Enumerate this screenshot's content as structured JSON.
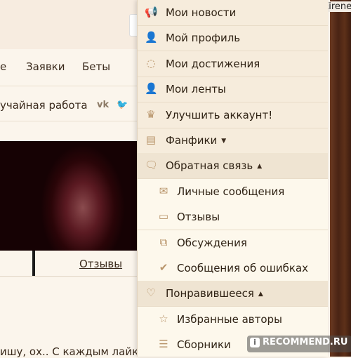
{
  "header": {
    "username": "Eirene"
  },
  "background_nav": {
    "partial_item": "е",
    "requests": "Заявки",
    "betas": "Беты"
  },
  "background_row": {
    "random_work": "учайная работа",
    "vk": "vk",
    "twitter": "🐦"
  },
  "background_tabs": {
    "reviews": "Отзывы"
  },
  "background_text": "ишу, ох.. С каждым лайк",
  "menu": [
    {
      "label": "Мои новости",
      "icon": "megaphone-icon",
      "glyph": "📢",
      "level": "top"
    },
    {
      "label": "Мой профиль",
      "icon": "user-icon",
      "glyph": "👤",
      "level": "top"
    },
    {
      "label": "Мои достижения",
      "icon": "laurel-icon",
      "glyph": "◌",
      "level": "top"
    },
    {
      "label": "Мои ленты",
      "icon": "user-icon",
      "glyph": "👤",
      "level": "top"
    },
    {
      "label": "Улучшить аккаунт!",
      "icon": "crown-icon",
      "glyph": "♛",
      "level": "top"
    },
    {
      "label": "Фанфики",
      "icon": "books-icon",
      "glyph": "▤",
      "level": "top",
      "caret": "▼"
    },
    {
      "label": "Обратная связь",
      "icon": "chat-icon",
      "glyph": "🗨",
      "level": "top",
      "caret": "▲",
      "open": true
    },
    {
      "label": "Личные сообщения",
      "icon": "envelope-icon",
      "glyph": "✉",
      "level": "sub"
    },
    {
      "label": "Отзывы",
      "icon": "comment-icon",
      "glyph": "▭",
      "level": "sub"
    },
    {
      "label": "Обсуждения",
      "icon": "comments-icon",
      "glyph": "⧉",
      "level": "sub"
    },
    {
      "label": "Сообщения об ошибках",
      "icon": "spellcheck-icon",
      "glyph": "✔",
      "level": "sub"
    },
    {
      "label": "Понравившееся",
      "icon": "heart-icon",
      "glyph": "♡",
      "level": "top",
      "caret": "▲",
      "open": true
    },
    {
      "label": "Избранные авторы",
      "icon": "star-icon",
      "glyph": "☆",
      "level": "sub"
    },
    {
      "label": "Сборники",
      "icon": "layers-icon",
      "glyph": "☰",
      "level": "sub"
    }
  ],
  "watermark": {
    "text": "RECOMMEND.RU",
    "badge": "i"
  },
  "colors": {
    "accent_icon": "#b8946a",
    "menu_bg": "#f6ecdc",
    "sub_bg": "#fdf8ec",
    "wood": "#4a2414"
  }
}
